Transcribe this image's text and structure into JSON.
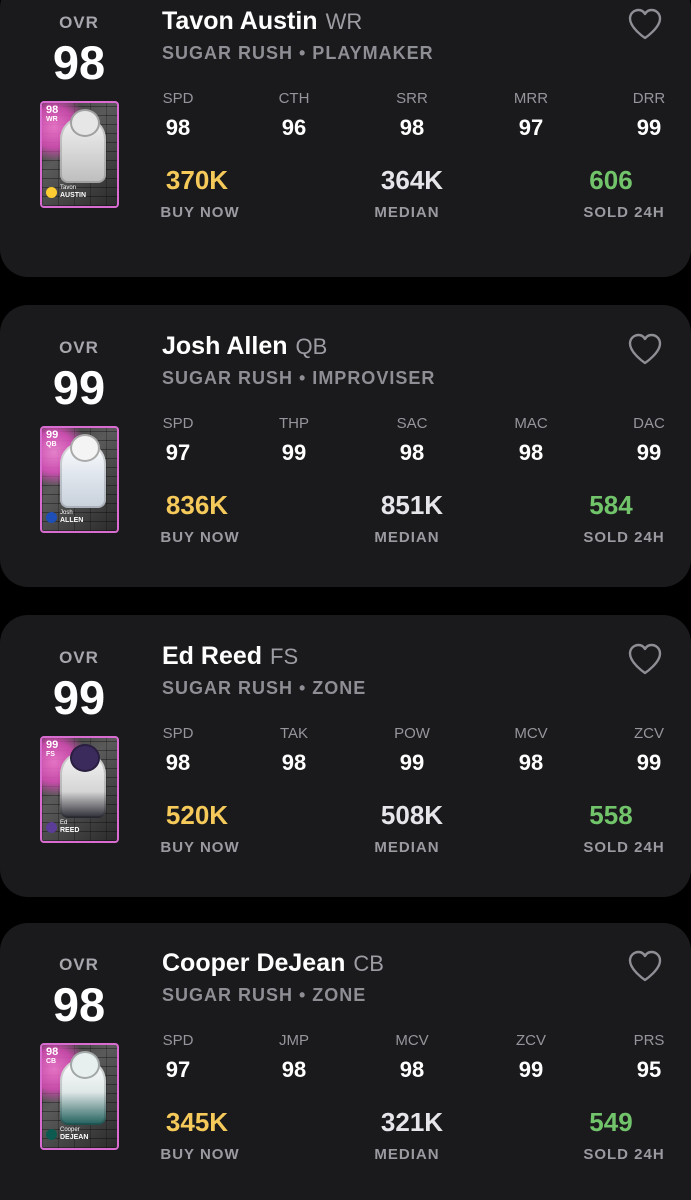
{
  "cards": [
    {
      "ovr_label": "OVR",
      "ovr": "98",
      "name": "Tavon Austin",
      "position": "WR",
      "subtitle": "SUGAR RUSH • PLAYMAKER",
      "card_art": {
        "number": "98",
        "pos": "WR",
        "first": "Tavon",
        "last": "AUSTIN"
      },
      "stats": [
        {
          "label": "SPD",
          "value": "98"
        },
        {
          "label": "CTH",
          "value": "96"
        },
        {
          "label": "SRR",
          "value": "98"
        },
        {
          "label": "MRR",
          "value": "97"
        },
        {
          "label": "DRR",
          "value": "99"
        }
      ],
      "buy_now": "370K",
      "buy_now_label": "BUY NOW",
      "median": "364K",
      "median_label": "MEDIAN",
      "sold": "606",
      "sold_label": "SOLD 24H"
    },
    {
      "ovr_label": "OVR",
      "ovr": "99",
      "name": "Josh Allen",
      "position": "QB",
      "subtitle": "SUGAR RUSH • IMPROVISER",
      "card_art": {
        "number": "99",
        "pos": "QB",
        "first": "Josh",
        "last": "ALLEN"
      },
      "stats": [
        {
          "label": "SPD",
          "value": "97"
        },
        {
          "label": "THP",
          "value": "99"
        },
        {
          "label": "SAC",
          "value": "98"
        },
        {
          "label": "MAC",
          "value": "98"
        },
        {
          "label": "DAC",
          "value": "99"
        }
      ],
      "buy_now": "836K",
      "buy_now_label": "BUY NOW",
      "median": "851K",
      "median_label": "MEDIAN",
      "sold": "584",
      "sold_label": "SOLD 24H"
    },
    {
      "ovr_label": "OVR",
      "ovr": "99",
      "name": "Ed Reed",
      "position": "FS",
      "subtitle": "SUGAR RUSH • ZONE",
      "card_art": {
        "number": "99",
        "pos": "FS",
        "first": "Ed",
        "last": "REED"
      },
      "stats": [
        {
          "label": "SPD",
          "value": "98"
        },
        {
          "label": "TAK",
          "value": "98"
        },
        {
          "label": "POW",
          "value": "99"
        },
        {
          "label": "MCV",
          "value": "98"
        },
        {
          "label": "ZCV",
          "value": "99"
        }
      ],
      "buy_now": "520K",
      "buy_now_label": "BUY NOW",
      "median": "508K",
      "median_label": "MEDIAN",
      "sold": "558",
      "sold_label": "SOLD 24H"
    },
    {
      "ovr_label": "OVR",
      "ovr": "98",
      "name": "Cooper DeJean",
      "position": "CB",
      "subtitle": "SUGAR RUSH • ZONE",
      "card_art": {
        "number": "98",
        "pos": "CB",
        "first": "Cooper",
        "last": "DEJEAN"
      },
      "stats": [
        {
          "label": "SPD",
          "value": "97"
        },
        {
          "label": "JMP",
          "value": "98"
        },
        {
          "label": "MCV",
          "value": "98"
        },
        {
          "label": "ZCV",
          "value": "99"
        },
        {
          "label": "PRS",
          "value": "95"
        }
      ],
      "buy_now": "345K",
      "buy_now_label": "BUY NOW",
      "median": "321K",
      "median_label": "MEDIAN",
      "sold": "549",
      "sold_label": "SOLD 24H"
    }
  ],
  "icons": {
    "favorite": "heart-outline-icon"
  },
  "colors": {
    "background": "#000000",
    "card": "#1a1a1c",
    "buy_now": "#f5c95a",
    "median": "#e6e6ea",
    "sold": "#71c46a",
    "muted": "#8e8e95"
  }
}
